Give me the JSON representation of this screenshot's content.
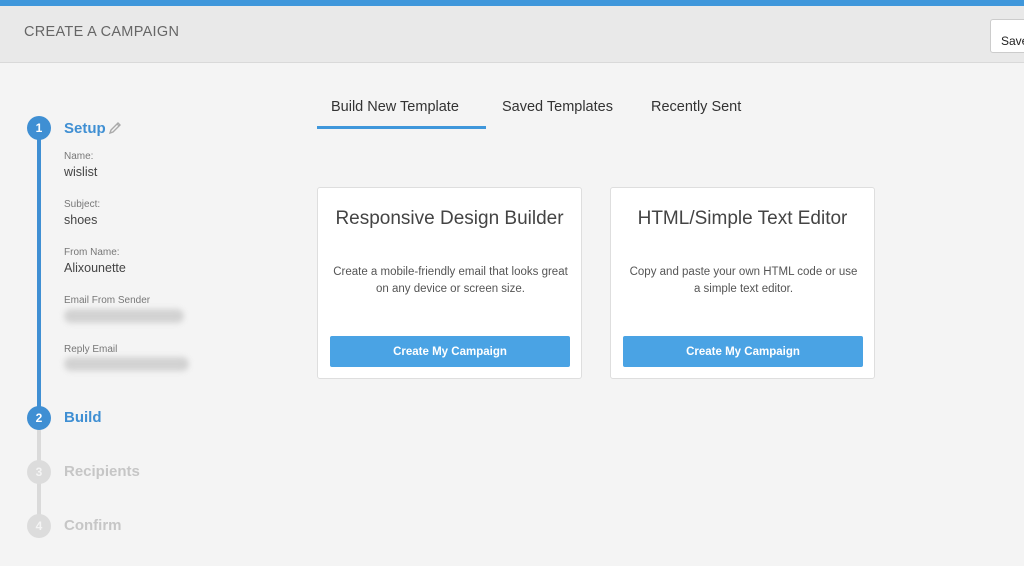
{
  "header": {
    "title": "CREATE A CAMPAIGN",
    "save_label": "Save"
  },
  "steps": [
    {
      "number": "1",
      "label": "Setup",
      "state": "active"
    },
    {
      "number": "2",
      "label": "Build",
      "state": "active"
    },
    {
      "number": "3",
      "label": "Recipients",
      "state": "inactive"
    },
    {
      "number": "4",
      "label": "Confirm",
      "state": "inactive"
    }
  ],
  "setup_fields": {
    "name_label": "Name:",
    "name_value": "wislist",
    "subject_label": "Subject:",
    "subject_value": "shoes",
    "from_name_label": "From Name:",
    "from_name_value": "Alixounette",
    "email_from_label": "Email From Sender",
    "reply_email_label": "Reply Email"
  },
  "tabs": [
    {
      "label": "Build New Template",
      "selected": true
    },
    {
      "label": "Saved Templates",
      "selected": false
    },
    {
      "label": "Recently Sent",
      "selected": false
    }
  ],
  "cards": [
    {
      "title": "Responsive Design Builder",
      "description": "Create a mobile-friendly email that looks great on any device or screen size.",
      "button": "Create My Campaign"
    },
    {
      "title": "HTML/Simple Text Editor",
      "description": "Copy and paste your own HTML code or use a simple text editor.",
      "button": "Create My Campaign"
    }
  ],
  "colors": {
    "accent": "#3f8fd3",
    "button": "#4aa3e4",
    "inactive_step": "#dcdcdc"
  },
  "icons": {
    "edit": "pencil-icon"
  }
}
